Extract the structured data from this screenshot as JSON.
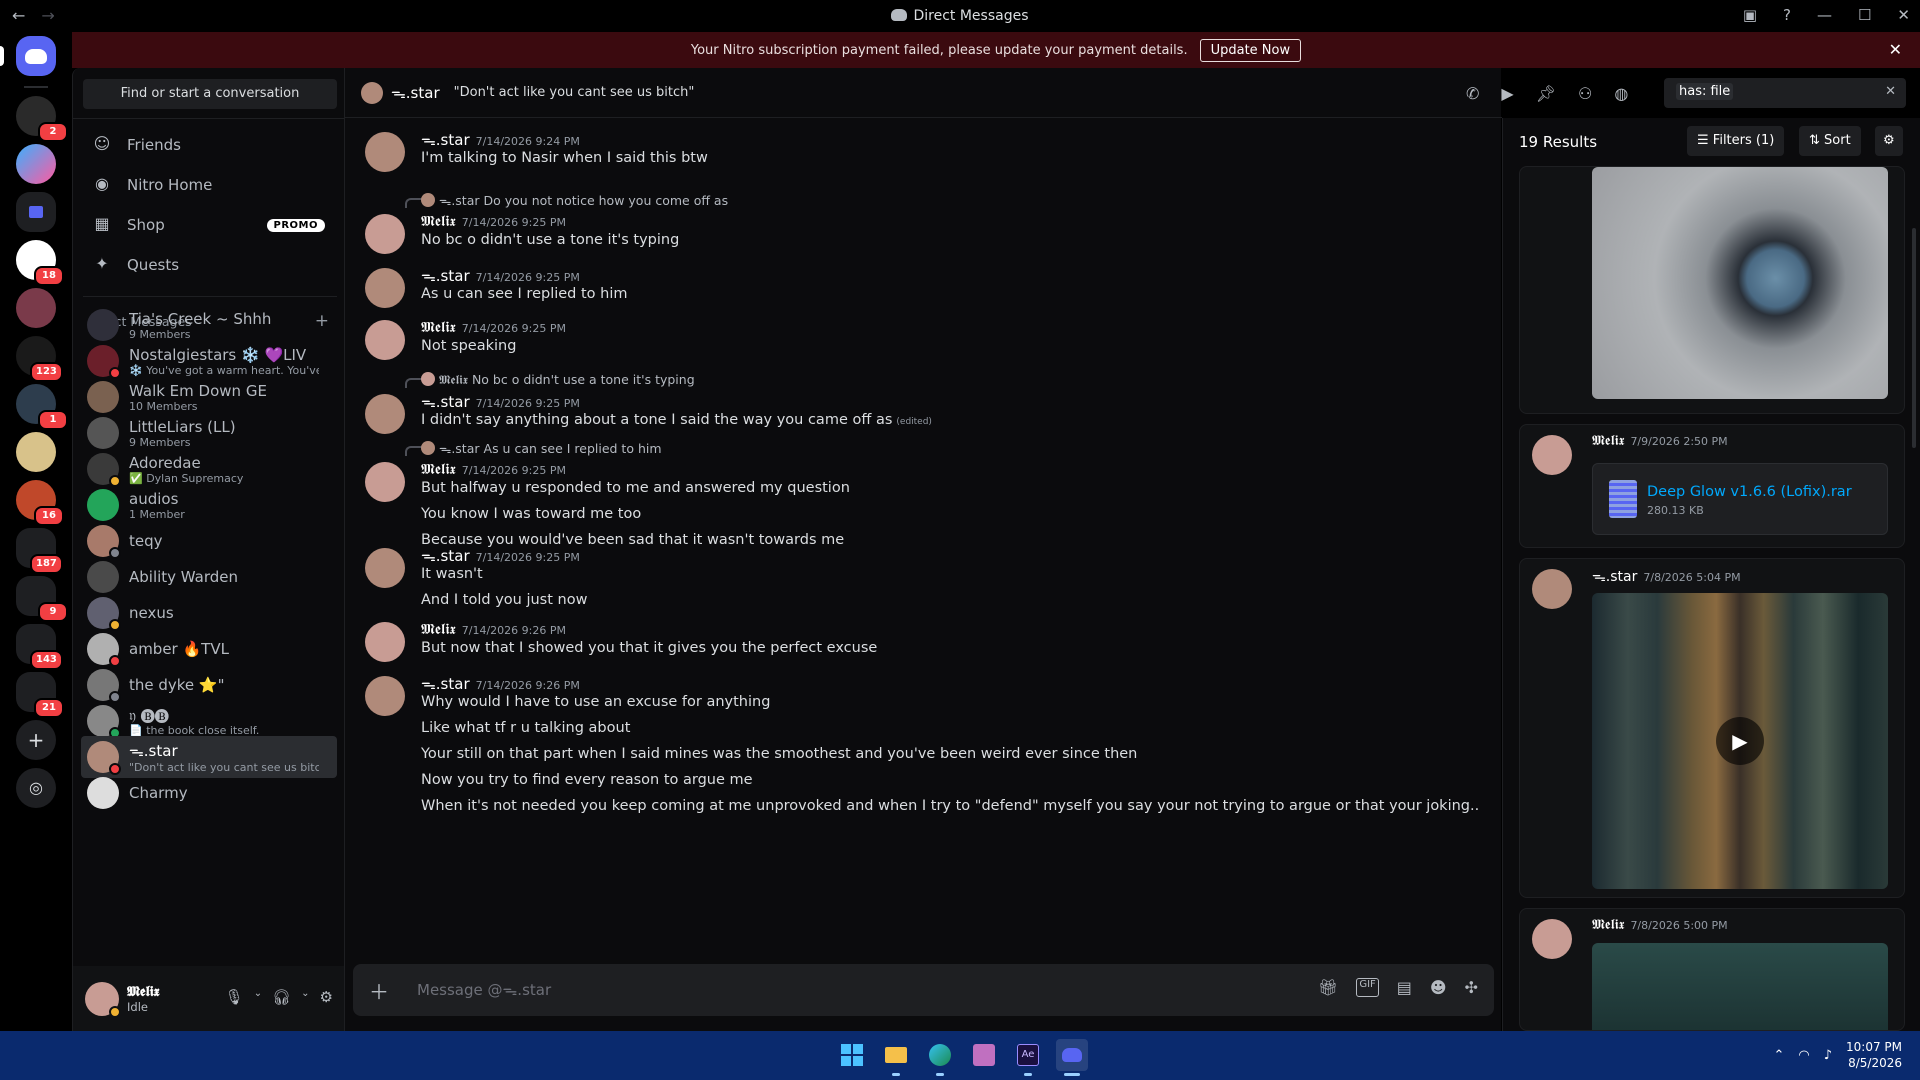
{
  "window": {
    "title": "Direct Messages"
  },
  "banner": {
    "text": "Your Nitro subscription payment failed, please update your payment details.",
    "button": "Update Now"
  },
  "guild_badges": [
    "2",
    "18",
    "123",
    "1",
    "16",
    "187",
    "9",
    "143",
    "21"
  ],
  "sidebar": {
    "search_placeholder": "Find or start a conversation",
    "nav": [
      {
        "label": "Friends",
        "icon": "friends-icon"
      },
      {
        "label": "Nitro Home",
        "icon": "nitro-icon"
      },
      {
        "label": "Shop",
        "icon": "shop-icon",
        "badge": "PROMO"
      },
      {
        "label": "Quests",
        "icon": "quests-icon"
      }
    ],
    "dm_header": "Direct Messages",
    "dms": [
      {
        "name": "Tia's Creek ~ Shhh",
        "sub": "9 Members",
        "color": "#2f2f3a",
        "status": ""
      },
      {
        "name": "Nostalgiestars ❄️ 💜LIV",
        "sub": "❄️ You've got a warm heart. You've ...",
        "color": "#6b1f2a",
        "status": "#f23f43"
      },
      {
        "name": "Walk Em Down GE",
        "sub": "10 Members",
        "color": "#7a6150",
        "status": ""
      },
      {
        "name": "LittleLiars (LL)",
        "sub": "9 Members",
        "color": "#555",
        "status": ""
      },
      {
        "name": "Adoredae",
        "sub": "✅ Dylan Supremacy",
        "color": "#3a3a3a",
        "status": "#f0b232"
      },
      {
        "name": "audios",
        "sub": "1 Member",
        "color": "#23a55a",
        "status": ""
      },
      {
        "name": "teqy",
        "sub": "",
        "color": "#a87a6a",
        "status": "#80848e"
      },
      {
        "name": "Ability Warden",
        "sub": "",
        "color": "#4a4a4a",
        "status": ""
      },
      {
        "name": "nexus",
        "sub": "",
        "color": "#606070",
        "status": "#f0b232"
      },
      {
        "name": "amber 🔥TVL",
        "sub": "",
        "color": "#b0b0b0",
        "status": "#f23f43"
      },
      {
        "name": "the dyke ⭐\"",
        "sub": "",
        "color": "#777",
        "status": "#80848e"
      },
      {
        "name": "𝔶 🅑🅑",
        "sub": "📄 the book close itself.",
        "color": "#888",
        "status": "#23a55a"
      },
      {
        "name": "ᯓ.star",
        "sub": "\"Don't act like you cant see us bitch\"",
        "color": "#b08a7a",
        "status": "#f23f43"
      },
      {
        "name": "Charmy",
        "sub": "",
        "color": "#ddd",
        "status": ""
      }
    ],
    "user": {
      "name": "𝕸𝖊𝖑𝖎𝖝",
      "status": "Idle"
    }
  },
  "channel": {
    "name": "ᯓ.star",
    "status": "\"Don't act like you cant see us bitch\"",
    "composer_placeholder": "Message @ᯓ.star"
  },
  "search": {
    "query": "has: file"
  },
  "messages": [
    {
      "author": "ᯓ.star",
      "time": "7/14/2026 9:24 PM",
      "lines": [
        "I'm talking to Nasir when I said this btw"
      ]
    },
    {
      "reply_to": "ᯓ.star",
      "reply_text": "Do you not notice how you come off as",
      "author": "𝕸𝖊𝖑𝖎𝖝",
      "time": "7/14/2026 9:25 PM",
      "lines": [
        "No bc o didn't use a tone it's typing"
      ]
    },
    {
      "author": "ᯓ.star",
      "time": "7/14/2026 9:25 PM",
      "lines": [
        "As u can see I replied to him"
      ]
    },
    {
      "author": "𝕸𝖊𝖑𝖎𝖝",
      "time": "7/14/2026 9:25 PM",
      "lines": [
        "Not speaking"
      ]
    },
    {
      "reply_to": "𝕸𝖊𝖑𝖎𝖝",
      "reply_text": "No bc o didn't use a tone it's typing",
      "author": "ᯓ.star",
      "time": "7/14/2026 9:25 PM",
      "lines": [
        "I didn't say anything about a tone I said the way you came off as"
      ],
      "edited": "(edited)"
    },
    {
      "reply_to": "ᯓ.star",
      "reply_text": "As u can see I replied to him",
      "author": "𝕸𝖊𝖑𝖎𝖝",
      "time": "7/14/2026 9:25 PM",
      "lines": [
        "But halfway u responded to me and answered my question",
        "You know I was toward me too",
        "Because you would've been sad that it wasn't towards me"
      ]
    },
    {
      "author": "ᯓ.star",
      "time": "7/14/2026 9:25 PM",
      "lines": [
        "It wasn't",
        "And I told you just now"
      ]
    },
    {
      "author": "𝕸𝖊𝖑𝖎𝖝",
      "time": "7/14/2026 9:26 PM",
      "lines": [
        "But now that I showed you that it gives you the perfect excuse"
      ]
    },
    {
      "author": "ᯓ.star",
      "time": "7/14/2026 9:26 PM",
      "lines": [
        "Why would I have to use an excuse for anything",
        "Like what tf r u talking about",
        "Your still on that part when I said mines was the smoothest and you've been weird ever since then",
        "Now you try to find every reason to argue me",
        "When it's not needed you keep coming at me unprovoked and when I try to \"defend\" myself you say your not trying to argue or that your joking.."
      ]
    }
  ],
  "results": {
    "count": "19 Results",
    "filters": "Filters (1)",
    "sort": "Sort",
    "items": [
      {
        "author": "𝕸𝖊𝖑𝖎𝖝",
        "time": "7/9/2026 2:50 PM",
        "file": "Deep Glow v1.6.6 (Lofix).rar",
        "size": "280.13 KB"
      },
      {
        "author": "ᯓ.star",
        "time": "7/8/2026 5:04 PM"
      },
      {
        "author": "𝕸𝖊𝖑𝖎𝖝",
        "time": "7/8/2026 5:00 PM"
      }
    ]
  },
  "taskbar": {
    "time": "10:07 PM",
    "date": "8/5/2026"
  }
}
